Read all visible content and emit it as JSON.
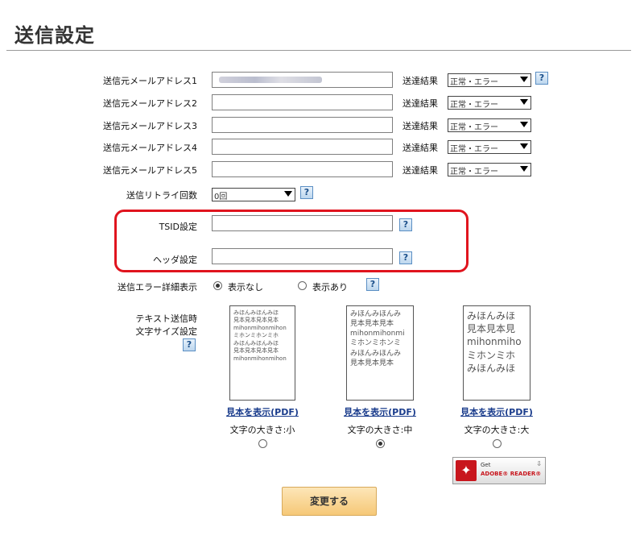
{
  "page_title": "送信設定",
  "sender_rows": [
    {
      "label": "送信元メールアドレス1",
      "value": "",
      "result_label": "送達結果",
      "result_value": "正常・エラー"
    },
    {
      "label": "送信元メールアドレス2",
      "value": "",
      "result_label": "送達結果",
      "result_value": "正常・エラー"
    },
    {
      "label": "送信元メールアドレス3",
      "value": "",
      "result_label": "送達結果",
      "result_value": "正常・エラー"
    },
    {
      "label": "送信元メールアドレス4",
      "value": "",
      "result_label": "送達結果",
      "result_value": "正常・エラー"
    },
    {
      "label": "送信元メールアドレス5",
      "value": "",
      "result_label": "送達結果",
      "result_value": "正常・エラー"
    }
  ],
  "retry": {
    "label": "送信リトライ回数",
    "value": "0回"
  },
  "tsid": {
    "label": "TSID設定",
    "value": ""
  },
  "header": {
    "label": "ヘッダ設定",
    "value": ""
  },
  "error_detail": {
    "label": "送信エラー詳細表示",
    "options": [
      "表示なし",
      "表示あり"
    ],
    "selected": "表示なし"
  },
  "text_size": {
    "label_line1": "テキスト送信時",
    "label_line2": "文字サイズ設定",
    "help_icon": "help-icon",
    "samples": [
      {
        "lines": [
          "みほんみほんみほ",
          "見本見本見本見本",
          "mihonmihonmihon",
          "ミホンミホンミホ",
          "みほんみほんみほ",
          "見本見本見本見本",
          "mihonmihonmihon"
        ],
        "link": "見本を表示(PDF)",
        "caption": "文字の大きさ:小",
        "selected": false
      },
      {
        "lines": [
          "みほんみほんみ",
          "見本見本見本",
          "mihonmihonmi",
          "ミホンミホンミ",
          "みほんみほんみ",
          "見本見本見本"
        ],
        "link": "見本を表示(PDF)",
        "caption": "文字の大きさ:中",
        "selected": true
      },
      {
        "lines": [
          "みほんみほ",
          "見本見本見",
          "mihonmiho",
          "ミホンミホ",
          "みほんみほ"
        ],
        "link": "見本を表示(PDF)",
        "caption": "文字の大きさ:大",
        "selected": false
      }
    ]
  },
  "adobe_badge": {
    "get": "Get",
    "reader": "ADOBE® READER®",
    "icon": "adobe-pdf-icon"
  },
  "submit_label": "変更する",
  "help_glyph": "?",
  "colors": {
    "highlight_border": "#e0141e",
    "link": "#1a3c8c",
    "button": "#f6c877"
  }
}
